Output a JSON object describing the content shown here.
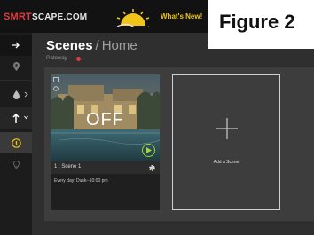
{
  "brand": {
    "red_part": "SMRT",
    "rest_part": "SCAPE.COM",
    "sun_icon": "sun-logo-icon"
  },
  "whats_new": "What's New!",
  "figure_label": "Figure 2",
  "colors": {
    "brand_red": "#e03a3e",
    "accent_yellow": "#f0c419",
    "play_green": "#a6d433",
    "status_red": "#e03a3e"
  },
  "sidebar": {
    "items": [
      {
        "icon": "arrow-right-icon"
      },
      {
        "icon": "location-pin-icon"
      },
      {
        "icon": "water-drop-icon"
      },
      {
        "icon": "arrow-up-icon"
      },
      {
        "icon": "info-circle-icon",
        "active": true
      },
      {
        "icon": "lightbulb-icon"
      }
    ]
  },
  "header": {
    "title": "Scenes",
    "separator": "/",
    "subtitle": "Home",
    "gateway_label": "Gateway"
  },
  "scene": {
    "state": "OFF",
    "name": "1 : Scene 1",
    "schedule": "Every day: Dusk--10:00 pm"
  },
  "add_scene": {
    "label": "Add a Scene"
  }
}
